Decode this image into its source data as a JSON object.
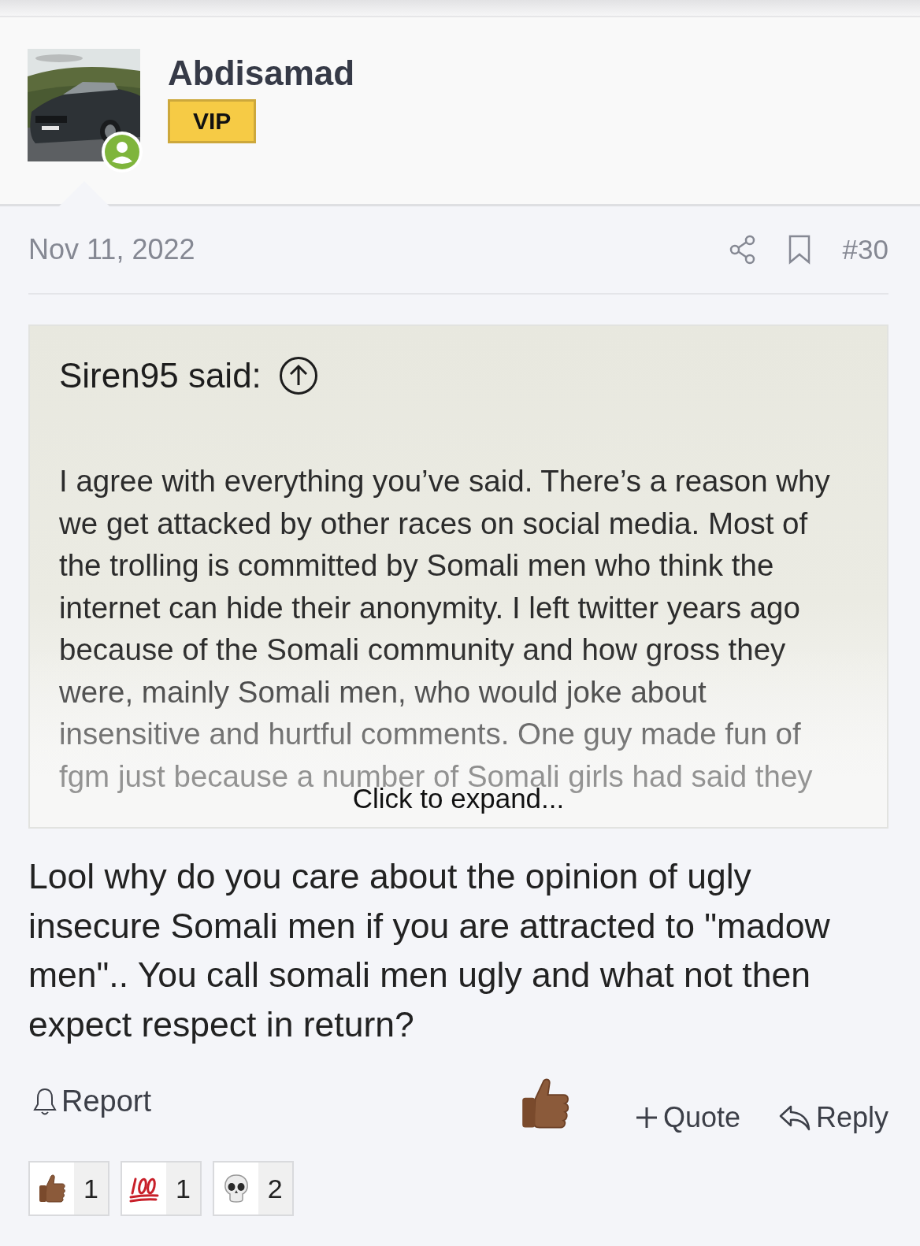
{
  "author": {
    "name": "Abdisamad",
    "badge": "VIP",
    "online": true
  },
  "post": {
    "date": "Nov 11, 2022",
    "number": "#30"
  },
  "quote": {
    "attribution": "Siren95 said:",
    "lines": [
      "I agree with everything you’ve said. There’s a reason why",
      "we get attacked by other races on social media. Most of",
      "the trolling is committed by Somali men who think the",
      "internet can hide their anonymity. I left twitter years ago",
      "because of the Somali community and how gross they",
      "were, mainly Somali men, who would joke about",
      "insensitive and hurtful comments. One guy made fun of",
      "fgm just because a number of Somali girls had said they"
    ],
    "expand": "Click to expand..."
  },
  "message": [
    "Lool why do you care about the opinion of ugly",
    "insecure Somali men if you are attracted to \"madow",
    "men\".. You call somali men ugly and what not then",
    "expect respect in return?"
  ],
  "actions": {
    "report": "Report",
    "quote": "Quote",
    "reply": "Reply"
  },
  "reactions": [
    {
      "kind": "thumbs_up",
      "count": "1"
    },
    {
      "kind": "hundred",
      "count": "1"
    },
    {
      "kind": "skull",
      "count": "2"
    }
  ]
}
